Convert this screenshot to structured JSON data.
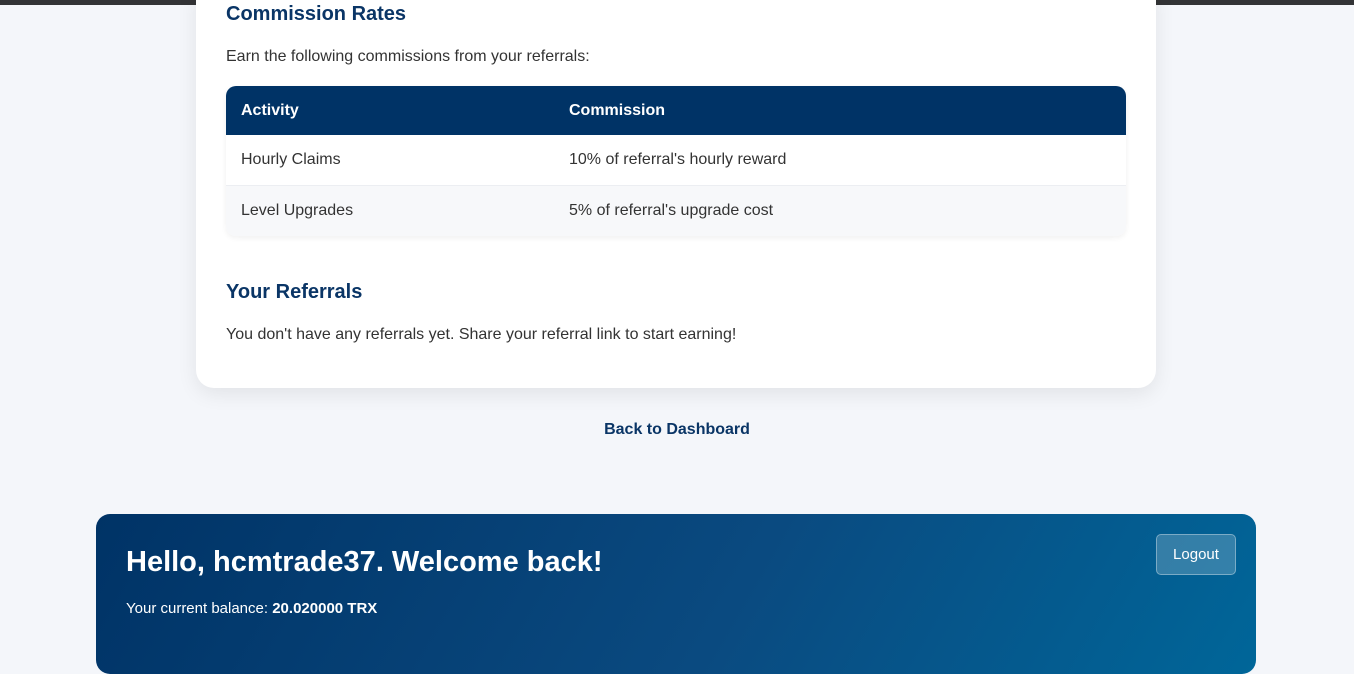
{
  "commission": {
    "title": "Commission Rates",
    "intro": "Earn the following commissions from your referrals:",
    "table": {
      "headers": [
        "Activity",
        "Commission"
      ],
      "rows": [
        [
          "Hourly Claims",
          "10% of referral's hourly reward"
        ],
        [
          "Level Upgrades",
          "5% of referral's upgrade cost"
        ]
      ]
    }
  },
  "referrals": {
    "title": "Your Referrals",
    "empty_message": "You don't have any referrals yet. Share your referral link to start earning!"
  },
  "back_link": "Back to Dashboard",
  "welcome": {
    "greeting": "Hello, hcmtrade37. Welcome back!",
    "balance_label": "Your current balance:",
    "balance_value": "20.020000 TRX",
    "logout_label": "Logout"
  }
}
